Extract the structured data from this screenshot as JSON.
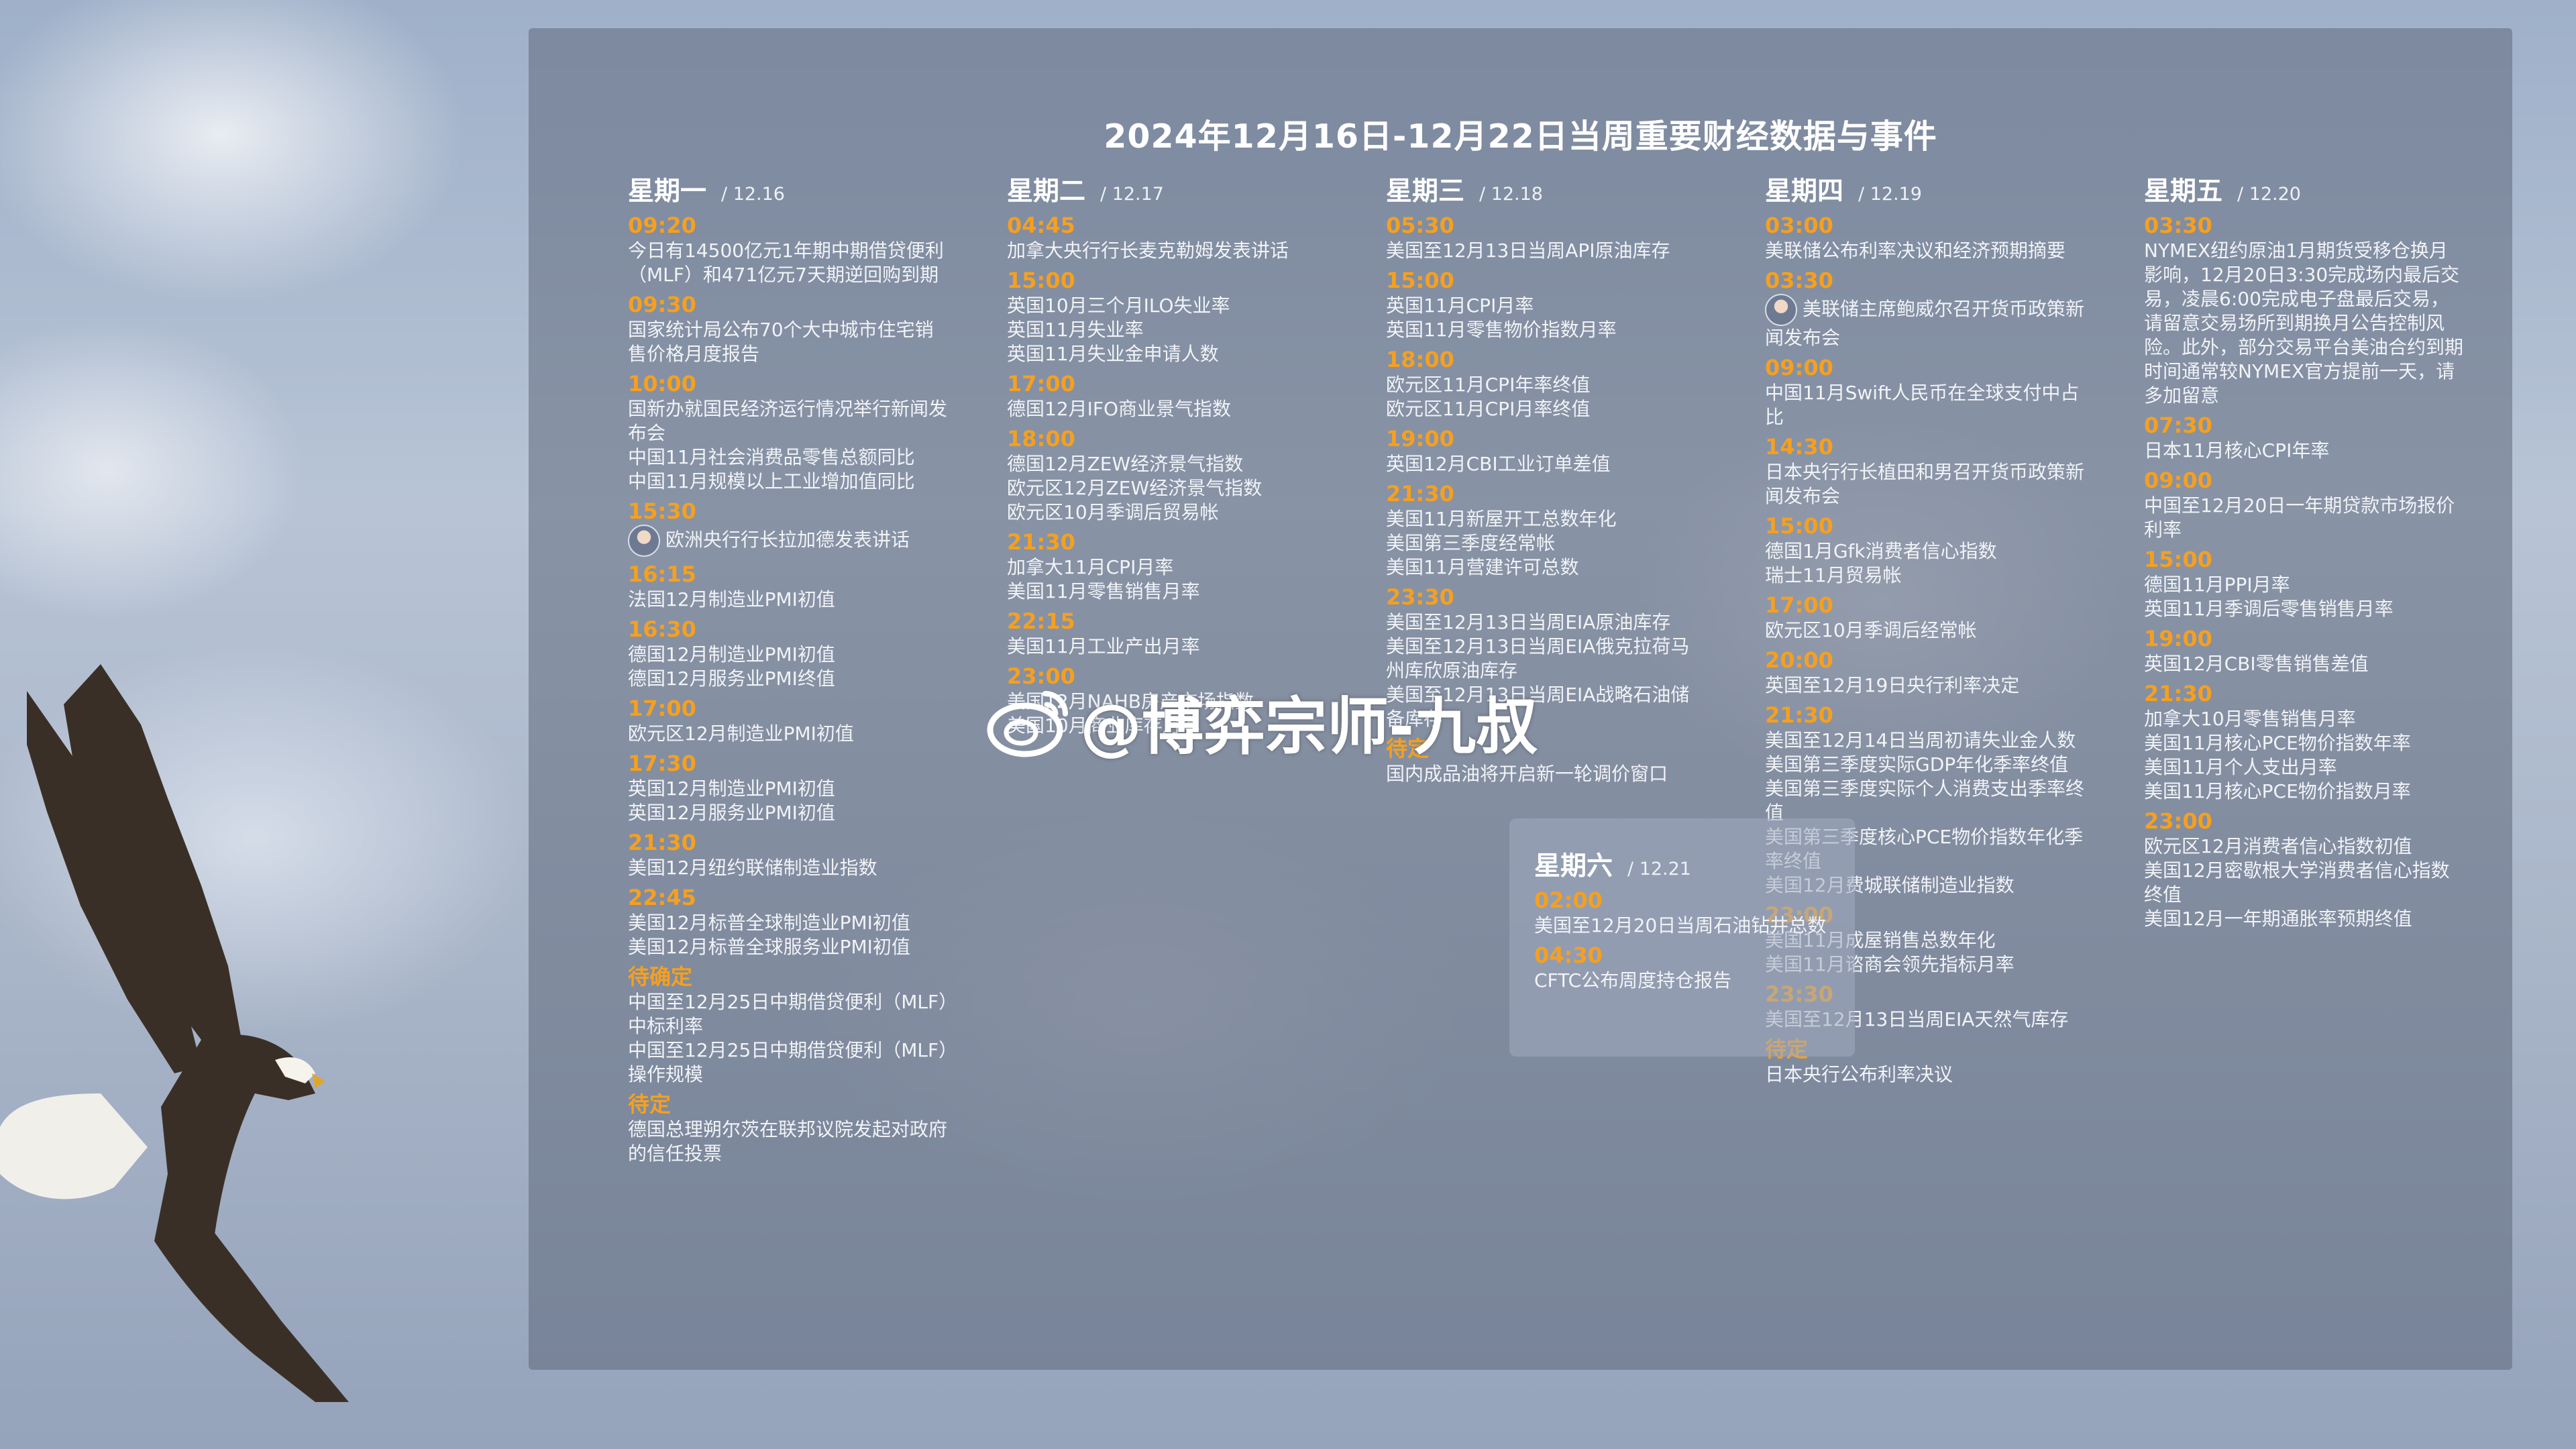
{
  "title": "2024年12月16日-12月22日当周重要财经数据与事件",
  "watermark": "@博弈宗师-九叔",
  "days": [
    {
      "name": "星期一",
      "date": "/ 12.16",
      "events": [
        {
          "time": "09:20",
          "items": [
            "今日有14500亿元1年期中期借贷便利（MLF）和471亿元7天期逆回购到期"
          ]
        },
        {
          "time": "09:30",
          "items": [
            "国家统计局公布70个大中城市住宅销售价格月度报告"
          ]
        },
        {
          "time": "10:00",
          "items": [
            "国新办就国民经济运行情况举行新闻发布会",
            "中国11月社会消费品零售总额同比",
            "中国11月规模以上工业增加值同比"
          ]
        },
        {
          "time": "15:30",
          "items": [
            "欧洲央行行长拉加德发表讲话"
          ]
        },
        {
          "time": "16:15",
          "items": [
            "法国12月制造业PMI初值"
          ]
        },
        {
          "time": "16:30",
          "items": [
            "德国12月制造业PMI初值",
            "德国12月服务业PMI终值"
          ]
        },
        {
          "time": "17:00",
          "items": [
            "欧元区12月制造业PMI初值"
          ]
        },
        {
          "time": "17:30",
          "items": [
            "英国12月制造业PMI初值",
            "英国12月服务业PMI初值"
          ]
        },
        {
          "time": "21:30",
          "items": [
            "美国12月纽约联储制造业指数"
          ]
        },
        {
          "time": "22:45",
          "items": [
            "美国12月标普全球制造业PMI初值",
            "美国12月标普全球服务业PMI初值"
          ]
        },
        {
          "time": "待确定",
          "items": [
            "中国至12月25日中期借贷便利（MLF）中标利率",
            "中国至12月25日中期借贷便利（MLF）操作规模"
          ]
        },
        {
          "time": "待定",
          "items": [
            "德国总理朔尔茨在联邦议院发起对政府的信任投票"
          ]
        }
      ]
    },
    {
      "name": "星期二",
      "date": "/ 12.17",
      "events": [
        {
          "time": "04:45",
          "items": [
            "加拿大央行行长麦克勒姆发表讲话"
          ]
        },
        {
          "time": "15:00",
          "items": [
            "英国10月三个月ILO失业率",
            "英国11月失业率",
            "英国11月失业金申请人数"
          ]
        },
        {
          "time": "17:00",
          "items": [
            "德国12月IFO商业景气指数"
          ]
        },
        {
          "time": "18:00",
          "items": [
            "德国12月ZEW经济景气指数",
            "欧元区12月ZEW经济景气指数",
            "欧元区10月季调后贸易帐"
          ]
        },
        {
          "time": "21:30",
          "items": [
            "加拿大11月CPI月率",
            "美国11月零售销售月率"
          ]
        },
        {
          "time": "22:15",
          "items": [
            "美国11月工业产出月率"
          ]
        },
        {
          "time": "23:00",
          "items": [
            "美国12月NAHB房产市场指数",
            "美国10月商业库存月率"
          ]
        }
      ]
    },
    {
      "name": "星期三",
      "date": "/ 12.18",
      "events": [
        {
          "time": "05:30",
          "items": [
            "美国至12月13日当周API原油库存"
          ]
        },
        {
          "time": "15:00",
          "items": [
            "英国11月CPI月率",
            "英国11月零售物价指数月率"
          ]
        },
        {
          "time": "18:00",
          "items": [
            "欧元区11月CPI年率终值",
            "欧元区11月CPI月率终值"
          ]
        },
        {
          "time": "19:00",
          "items": [
            "英国12月CBI工业订单差值"
          ]
        },
        {
          "time": "21:30",
          "items": [
            "美国11月新屋开工总数年化",
            "美国第三季度经常帐",
            "美国11月营建许可总数"
          ]
        },
        {
          "time": "23:30",
          "items": [
            "美国至12月13日当周EIA原油库存",
            "美国至12月13日当周EIA俄克拉荷马州库欣原油库存",
            "美国至12月13日当周EIA战略石油储备库存"
          ]
        },
        {
          "time": "待定",
          "items": [
            "国内成品油将开启新一轮调价窗口"
          ]
        }
      ]
    },
    {
      "name": "星期四",
      "date": "/ 12.19",
      "events": [
        {
          "time": "03:00",
          "items": [
            "美联储公布利率决议和经济预期摘要"
          ]
        },
        {
          "time": "03:30",
          "items": [
            "美联储主席鲍威尔召开货币政策新闻发布会"
          ]
        },
        {
          "time": "09:00",
          "items": [
            "中国11月Swift人民币在全球支付中占比"
          ]
        },
        {
          "time": "14:30",
          "items": [
            "日本央行行长植田和男召开货币政策新闻发布会"
          ]
        },
        {
          "time": "15:00",
          "items": [
            "德国1月Gfk消费者信心指数",
            "瑞士11月贸易帐"
          ]
        },
        {
          "time": "17:00",
          "items": [
            "欧元区10月季调后经常帐"
          ]
        },
        {
          "time": "20:00",
          "items": [
            "英国至12月19日央行利率决定"
          ]
        },
        {
          "time": "21:30",
          "items": [
            "美国至12月14日当周初请失业金人数",
            "美国第三季度实际GDP年化季率终值",
            "美国第三季度实际个人消费支出季率终值",
            "美国第三季度核心PCE物价指数年化季率终值",
            "美国12月费城联储制造业指数"
          ]
        },
        {
          "time": "23:00",
          "items": [
            "美国11月成屋销售总数年化",
            "美国11月谘商会领先指标月率"
          ]
        },
        {
          "time": "23:30",
          "items": [
            "美国至12月13日当周EIA天然气库存"
          ]
        },
        {
          "time": "待定",
          "items": [
            "日本央行公布利率决议"
          ]
        }
      ]
    },
    {
      "name": "星期五",
      "date": "/ 12.20",
      "events": [
        {
          "time": "03:30",
          "items": [
            "NYMEX纽约原油1月期货受移仓换月影响，12月20日3:30完成场内最后交易，凌晨6:00完成电子盘最后交易，请留意交易场所到期换月公告控制风险。此外，部分交易平台美油合约到期时间通常较NYMEX官方提前一天，请多加留意"
          ]
        },
        {
          "time": "07:30",
          "items": [
            "日本11月核心CPI年率"
          ]
        },
        {
          "time": "09:00",
          "items": [
            "中国至12月20日一年期贷款市场报价利率"
          ]
        },
        {
          "time": "15:00",
          "items": [
            "德国11月PPI月率",
            "英国11月季调后零售销售月率"
          ]
        },
        {
          "time": "19:00",
          "items": [
            "英国12月CBI零售销售差值"
          ]
        },
        {
          "time": "21:30",
          "items": [
            "加拿大10月零售销售月率",
            "美国11月核心PCE物价指数年率",
            "美国11月个人支出月率",
            "美国11月核心PCE物价指数月率"
          ]
        },
        {
          "time": "23:00",
          "items": [
            "欧元区12月消费者信心指数初值",
            "美国12月密歇根大学消费者信心指数终值",
            "美国12月一年期通胀率预期终值"
          ]
        }
      ]
    },
    {
      "name": "星期六",
      "date": "/ 12.21",
      "events": [
        {
          "time": "02:00",
          "items": [
            "美国至12月20日当周石油钻井总数"
          ]
        },
        {
          "time": "04:30",
          "items": [
            "CFTC公布周度持仓报告"
          ]
        }
      ]
    }
  ]
}
